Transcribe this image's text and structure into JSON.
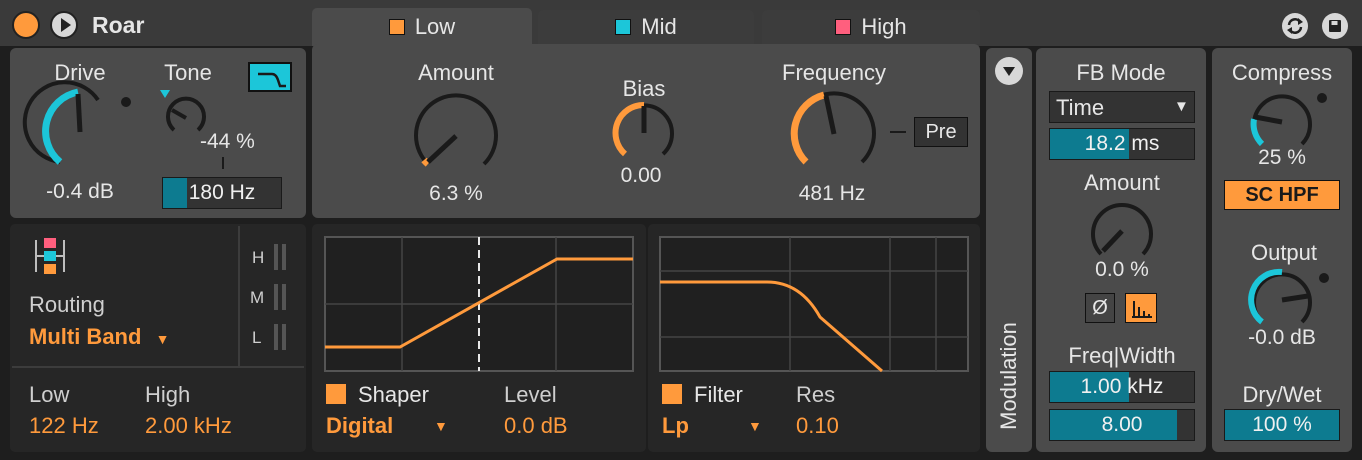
{
  "header": {
    "device_name": "Roar",
    "tabs": [
      {
        "label": "Low",
        "color": "#ff9a3c",
        "active": true
      },
      {
        "label": "Mid",
        "color": "#1cc6d9",
        "active": false
      },
      {
        "label": "High",
        "color": "#ff5f7e",
        "active": false
      }
    ]
  },
  "input": {
    "drive_label": "Drive",
    "drive_value": "-0.4 dB",
    "tone_label": "Tone",
    "tone_value": "-44 %",
    "tone_freq": "180 Hz",
    "tone_freq_fill": 0.2
  },
  "band": {
    "amount_label": "Amount",
    "amount_value": "6.3 %",
    "bias_label": "Bias",
    "bias_value": "0.00",
    "frequency_label": "Frequency",
    "frequency_value": "481 Hz",
    "pre_label": "Pre"
  },
  "routing": {
    "label": "Routing",
    "mode": "Multi Band",
    "meters": [
      "H",
      "M",
      "L"
    ],
    "low_label": "Low",
    "low_value": "122 Hz",
    "high_label": "High",
    "high_value": "2.00 kHz"
  },
  "shaper": {
    "label": "Shaper",
    "type": "Digital",
    "level_label": "Level",
    "level_value": "0.0 dB"
  },
  "filter": {
    "label": "Filter",
    "type": "Lp",
    "res_label": "Res",
    "res_value": "0.10"
  },
  "modulation": {
    "label": "Modulation"
  },
  "feedback": {
    "mode_label": "FB Mode",
    "mode_value": "Time",
    "time_value": "18.2 ms",
    "time_fill": 0.55,
    "amount_label": "Amount",
    "amount_value": "0.0 %",
    "phase_label": "Ø",
    "freqwidth_label": "Freq|Width",
    "freq_value": "1.00",
    "freq_unit": "kHz",
    "freq_fill": 0.55,
    "width_value": "8.00",
    "width_fill": 0.88
  },
  "output": {
    "compress_label": "Compress",
    "compress_value": "25 %",
    "schpf_label": "SC HPF",
    "output_label": "Output",
    "output_value": "-0.0 dB",
    "drywet_label": "Dry/Wet",
    "drywet_value": "100 %"
  },
  "colors": {
    "accent_orange": "#ff9a3c",
    "accent_cyan": "#1cc6d9",
    "accent_pink": "#ff5f7e",
    "panel": "#4b4b4b",
    "dark": "#262626"
  }
}
